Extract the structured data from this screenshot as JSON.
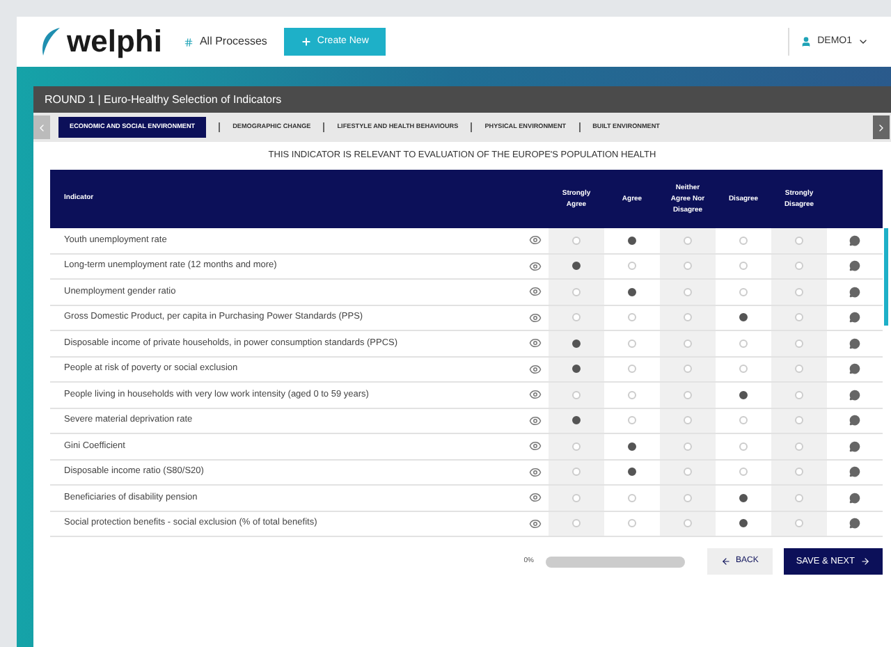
{
  "header": {
    "logo": "welphi",
    "nav_link": "All Processes",
    "create_button": "Create New",
    "user": "DEMO1"
  },
  "panel": {
    "title": "ROUND 1 | Euro-Healthy Selection of Indicators"
  },
  "tabs": [
    {
      "label": "ECONOMIC AND SOCIAL ENVIRONMENT",
      "selected": true
    },
    {
      "label": "DEMOGRAPHIC CHANGE",
      "selected": false
    },
    {
      "label": "LIFESTYLE AND HEALTH BEHAVIOURS",
      "selected": false
    },
    {
      "label": "PHYSICAL ENVIRONMENT",
      "selected": false
    },
    {
      "label": "BUILT ENVIRONMENT",
      "selected": false
    }
  ],
  "question": "THIS INDICATOR IS RELEVANT TO EVALUATION OF THE EUROPE'S POPULATION HEALTH",
  "table": {
    "columns": [
      "Indicator",
      "Strongly Agree",
      "Agree",
      "Neither Agree Nor Disagree",
      "Disagree",
      "Strongly Disagree"
    ],
    "rows": [
      {
        "indicator": "Youth unemployment rate",
        "answers": [
          {
            "selected": false
          },
          {
            "selected": true
          },
          {
            "selected": false
          },
          {
            "selected": false
          },
          {
            "selected": false
          }
        ]
      },
      {
        "indicator": "Long-term unemployment rate (12 months and more)",
        "answers": [
          {
            "selected": true
          },
          {
            "selected": false
          },
          {
            "selected": false
          },
          {
            "selected": false
          },
          {
            "selected": false
          }
        ]
      },
      {
        "indicator": "Unemployment gender ratio",
        "answers": [
          {
            "selected": false
          },
          {
            "selected": true
          },
          {
            "selected": false
          },
          {
            "selected": false
          },
          {
            "selected": false
          }
        ]
      },
      {
        "indicator": "Gross Domestic Product, per capita in Purchasing Power Standards (PPS)",
        "answers": [
          {
            "selected": false
          },
          {
            "selected": false
          },
          {
            "selected": false
          },
          {
            "selected": true
          },
          {
            "selected": false
          }
        ]
      },
      {
        "indicator": "Disposable income of private households, in power consumption standards (PPCS)",
        "answers": [
          {
            "selected": true
          },
          {
            "selected": false
          },
          {
            "selected": false
          },
          {
            "selected": false
          },
          {
            "selected": false
          }
        ]
      },
      {
        "indicator": "People at risk of poverty or social exclusion",
        "answers": [
          {
            "selected": true
          },
          {
            "selected": false
          },
          {
            "selected": false
          },
          {
            "selected": false
          },
          {
            "selected": false
          }
        ]
      },
      {
        "indicator": "People living in households with very low work intensity (aged 0 to 59 years)",
        "answers": [
          {
            "selected": false
          },
          {
            "selected": false
          },
          {
            "selected": false
          },
          {
            "selected": true
          },
          {
            "selected": false
          }
        ]
      },
      {
        "indicator": "Severe material deprivation rate",
        "answers": [
          {
            "selected": true
          },
          {
            "selected": false
          },
          {
            "selected": false
          },
          {
            "selected": false
          },
          {
            "selected": false
          }
        ]
      },
      {
        "indicator": "Gini Coefficient",
        "answers": [
          {
            "selected": false
          },
          {
            "selected": true
          },
          {
            "selected": false
          },
          {
            "selected": false
          },
          {
            "selected": false
          }
        ]
      },
      {
        "indicator": "Disposable income ratio (S80/S20)",
        "answers": [
          {
            "selected": false
          },
          {
            "selected": true
          },
          {
            "selected": false
          },
          {
            "selected": false
          },
          {
            "selected": false
          }
        ]
      },
      {
        "indicator": "Beneficiaries of disability pension",
        "answers": [
          {
            "selected": false
          },
          {
            "selected": false
          },
          {
            "selected": false
          },
          {
            "selected": true
          },
          {
            "selected": false
          }
        ]
      },
      {
        "indicator": "Social protection benefits - social exclusion (% of total benefits)",
        "answers": [
          {
            "selected": false
          },
          {
            "selected": false
          },
          {
            "selected": false
          },
          {
            "selected": true
          },
          {
            "selected": false
          }
        ]
      }
    ]
  },
  "progress": {
    "reading": "0%",
    "level": 0
  },
  "buttons": {
    "back": "BACK",
    "next": "SAVE & NEXT"
  }
}
